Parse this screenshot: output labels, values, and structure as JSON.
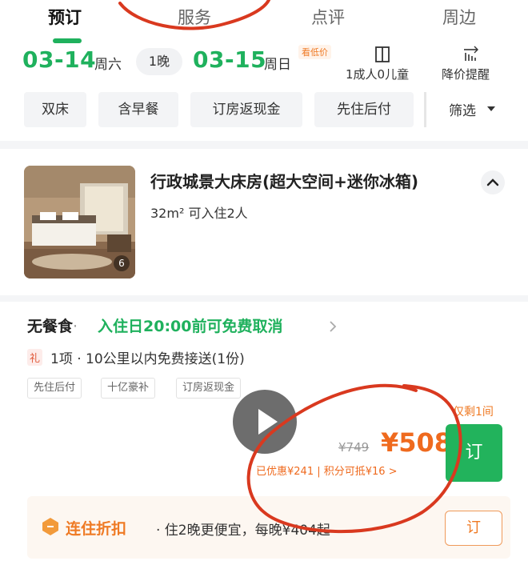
{
  "tabs": [
    "预订",
    "服务",
    "点评",
    "周边"
  ],
  "dates": {
    "checkin": "03-14",
    "checkin_weekday": "周六",
    "nights": "1晚",
    "checkout": "03-15",
    "checkout_weekday": "周日",
    "low_price_badge": "看低价",
    "guests": "1成人0儿童",
    "price_alert": "降价提醒"
  },
  "filters": [
    "双床",
    "含早餐",
    "订房返现金",
    "先住后付",
    "筛选"
  ],
  "room": {
    "title": "行政城景大床房(超大空间+迷你冰箱)",
    "subtitle": "32m² 可入住2人",
    "photo_count": "6"
  },
  "plan": {
    "meal": "无餐食",
    "separator": "·",
    "cancel_policy": "入住日20:00前可免费取消",
    "gift_badge": "礼",
    "gift_text": "1项 · 10公里以内免费接送(1份)",
    "tags": [
      "先住后付",
      "十亿豪补",
      "订房返现金"
    ],
    "remaining": "仅剩1间",
    "original_price": "¥749",
    "price": "¥508",
    "discount_line": "已优惠¥241 | 积分可抵¥16 >",
    "book_label": "订"
  },
  "promo": {
    "title": "连住折扣",
    "text": "· 住2晚更便宜，每晚¥404起",
    "book_label": "订"
  },
  "colors": {
    "accent_green": "#1fb15d",
    "price_orange": "#ef6a1e",
    "annotation_red": "#d9391f"
  },
  "icons": [
    "door-icon",
    "price-alert-icon",
    "chevron-up-icon",
    "play-icon",
    "discount-icon",
    "chevron-right-icon",
    "dropdown-icon"
  ]
}
